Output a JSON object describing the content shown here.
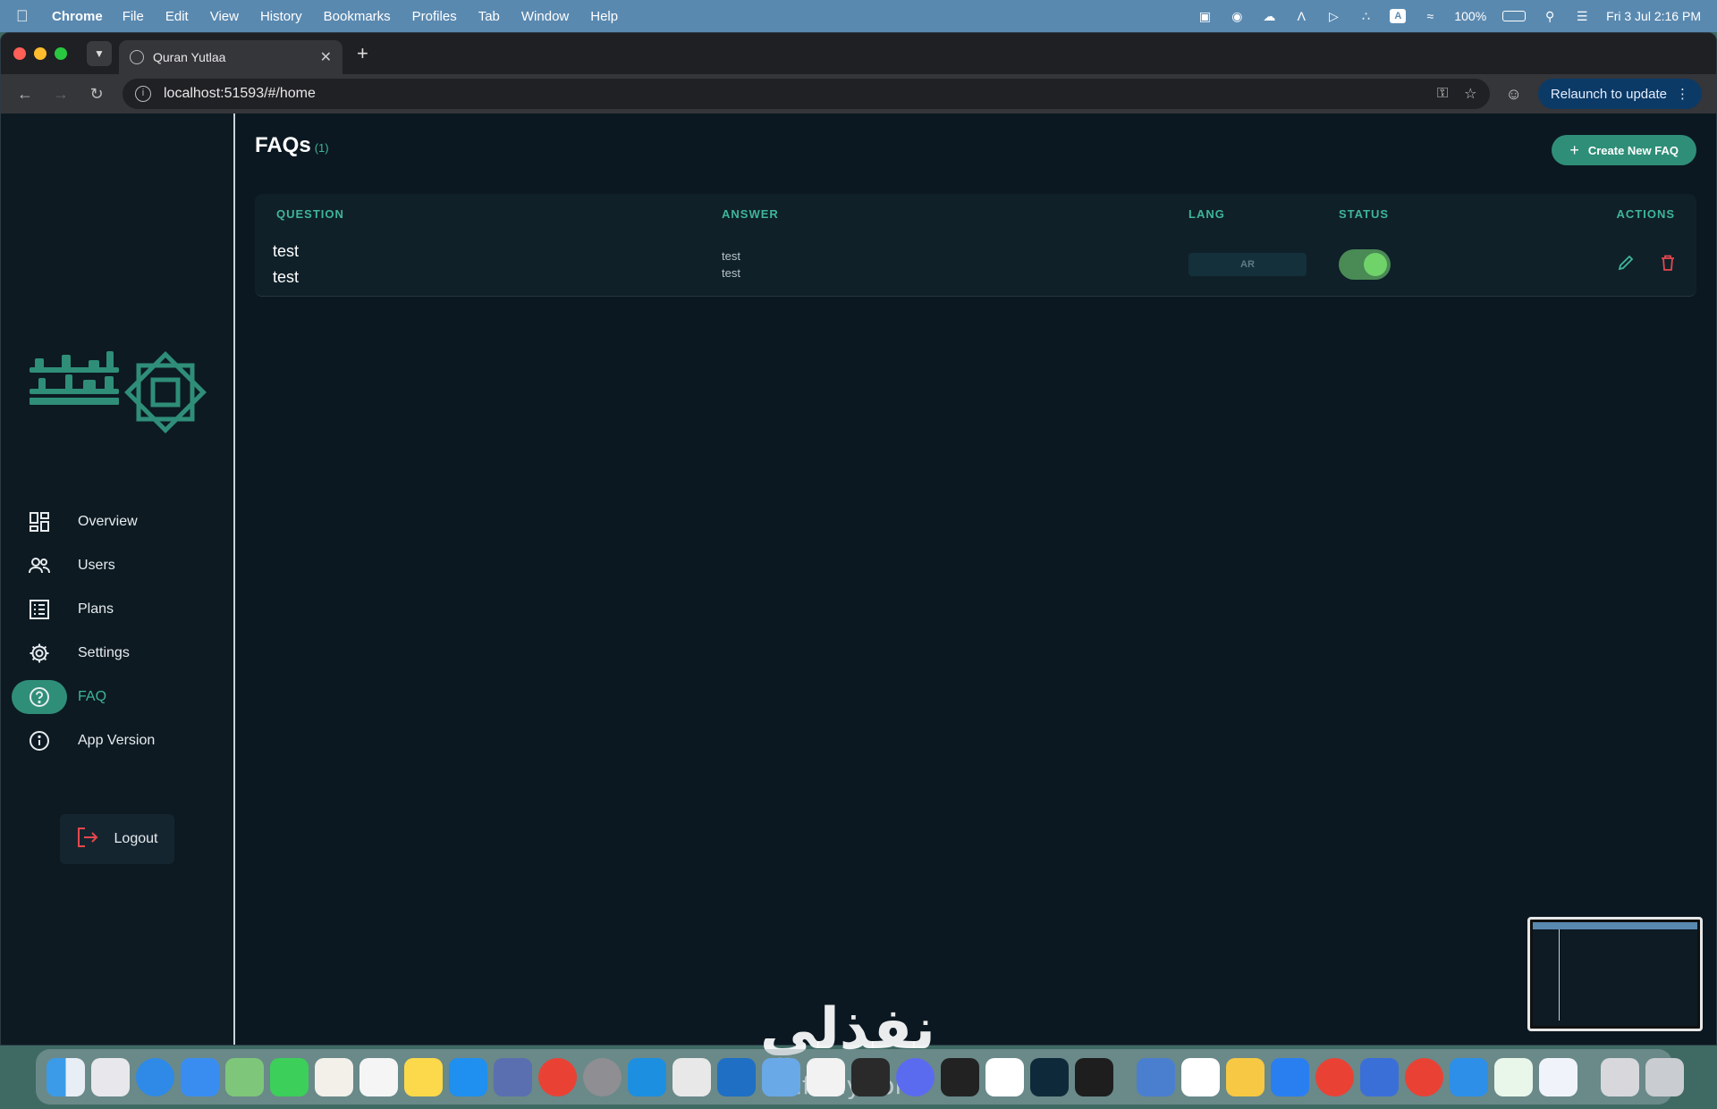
{
  "menubar": {
    "app_name": "Chrome",
    "menus": [
      "File",
      "Edit",
      "View",
      "History",
      "Bookmarks",
      "Profiles",
      "Tab",
      "Window",
      "Help"
    ],
    "battery": "100%",
    "datetime": "Fri 3 Jul  2:16 PM"
  },
  "browser": {
    "tab_title": "Quran Yutlaa",
    "url": "localhost:51593/#/home",
    "relaunch_label": "Relaunch to update"
  },
  "sidebar": {
    "items": [
      {
        "label": "Overview",
        "icon": "dashboard-icon"
      },
      {
        "label": "Users",
        "icon": "users-icon"
      },
      {
        "label": "Plans",
        "icon": "list-icon"
      },
      {
        "label": "Settings",
        "icon": "gear-icon"
      },
      {
        "label": "FAQ",
        "icon": "help-circle-icon",
        "active": true
      },
      {
        "label": "App Version",
        "icon": "info-icon"
      }
    ],
    "logout_label": "Logout"
  },
  "page": {
    "title": "FAQs",
    "count": "(1)",
    "create_label": "Create New FAQ"
  },
  "table": {
    "headers": {
      "question": "QUESTION",
      "answer": "ANSWER",
      "lang": "LANG",
      "status": "STATUS",
      "actions": "ACTIONS"
    },
    "rows": [
      {
        "question_1": "test",
        "question_2": "test",
        "answer_1": "test",
        "answer_2": "test",
        "lang": "AR",
        "status_enabled": true
      }
    ]
  },
  "watermark": {
    "main": "نفذلي",
    "sub": "nafezly.com"
  },
  "colors": {
    "accent": "#2f8e78",
    "accent_text": "#3fb59a",
    "background": "#0b1821",
    "danger": "#e5484d"
  }
}
